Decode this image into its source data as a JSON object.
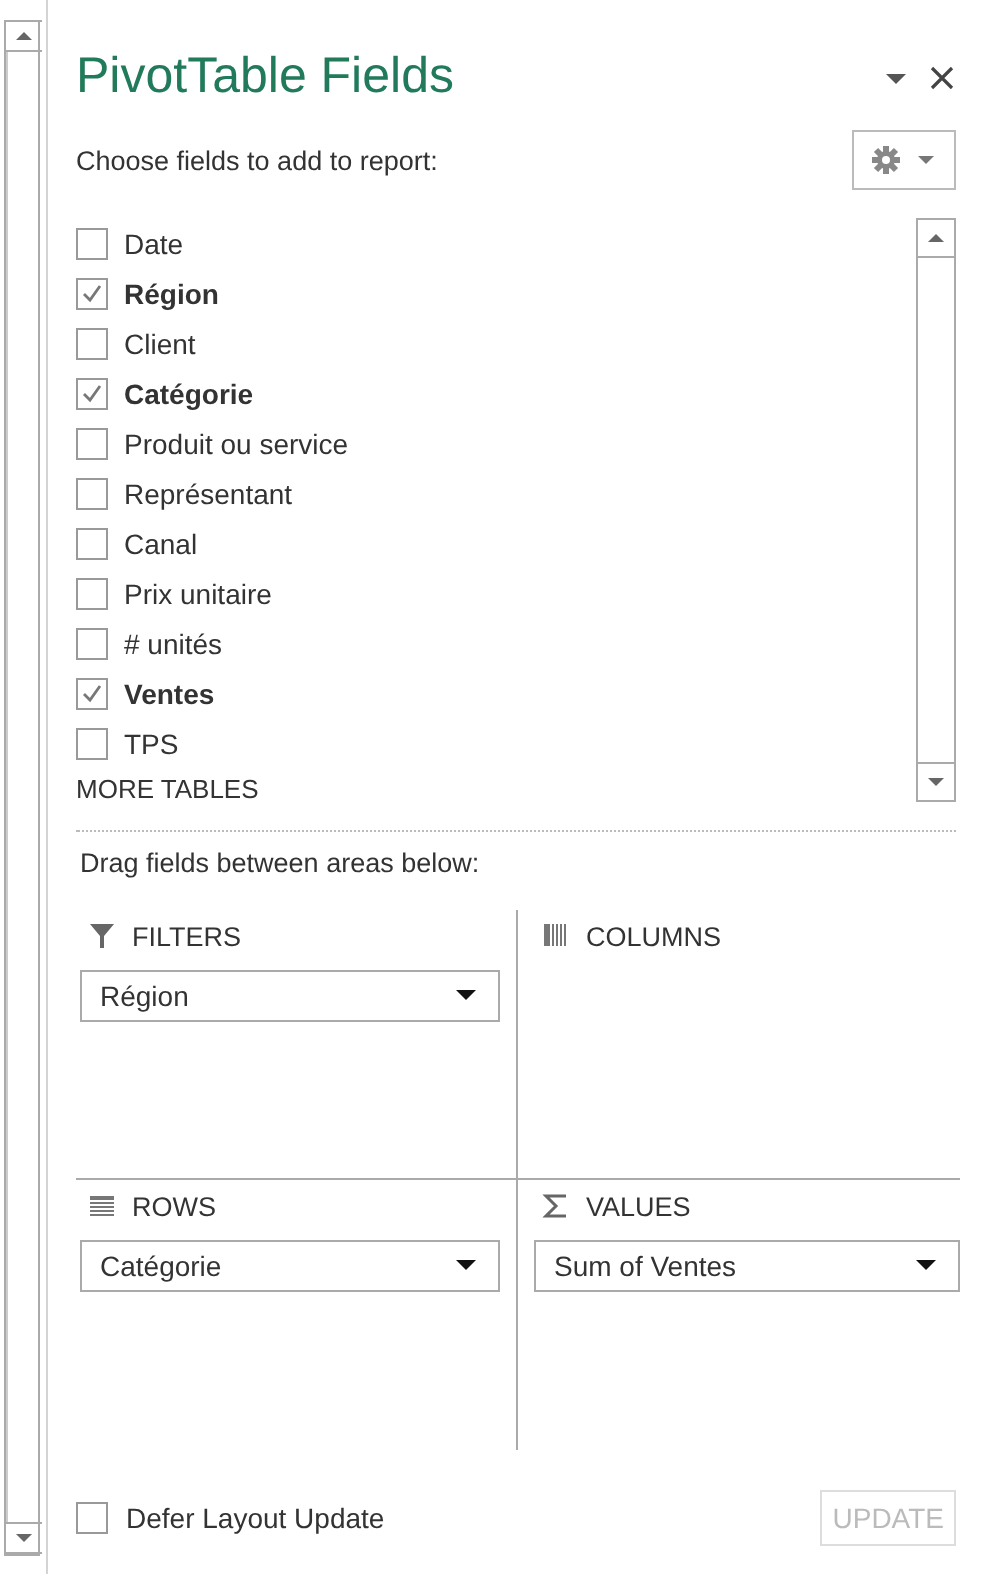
{
  "title": "PivotTable Fields",
  "subtitle": "Choose fields to add to report:",
  "fields": [
    {
      "label": "Date",
      "checked": false
    },
    {
      "label": "Région",
      "checked": true
    },
    {
      "label": "Client",
      "checked": false
    },
    {
      "label": "Catégorie",
      "checked": true
    },
    {
      "label": "Produit ou service",
      "checked": false
    },
    {
      "label": "Représentant",
      "checked": false
    },
    {
      "label": "Canal",
      "checked": false
    },
    {
      "label": "Prix unitaire",
      "checked": false
    },
    {
      "label": "# unités",
      "checked": false
    },
    {
      "label": "Ventes",
      "checked": true
    },
    {
      "label": "TPS",
      "checked": false
    }
  ],
  "more_tables": "MORE TABLES",
  "areas_label": "Drag fields between areas below:",
  "areas": [
    {
      "kind": "filters",
      "label": "FILTERS",
      "items": [
        "Région"
      ]
    },
    {
      "kind": "columns",
      "label": "COLUMNS"
    },
    {
      "kind": "rows",
      "label": "ROWS",
      "items": [
        "Catégorie"
      ]
    },
    {
      "kind": "values",
      "label": "VALUES",
      "items": [
        "Sum of Ventes"
      ]
    }
  ],
  "defer": {
    "label": "Defer Layout Update",
    "checked": false
  },
  "update_button": {
    "label": "UPDATE",
    "disabled": true
  }
}
